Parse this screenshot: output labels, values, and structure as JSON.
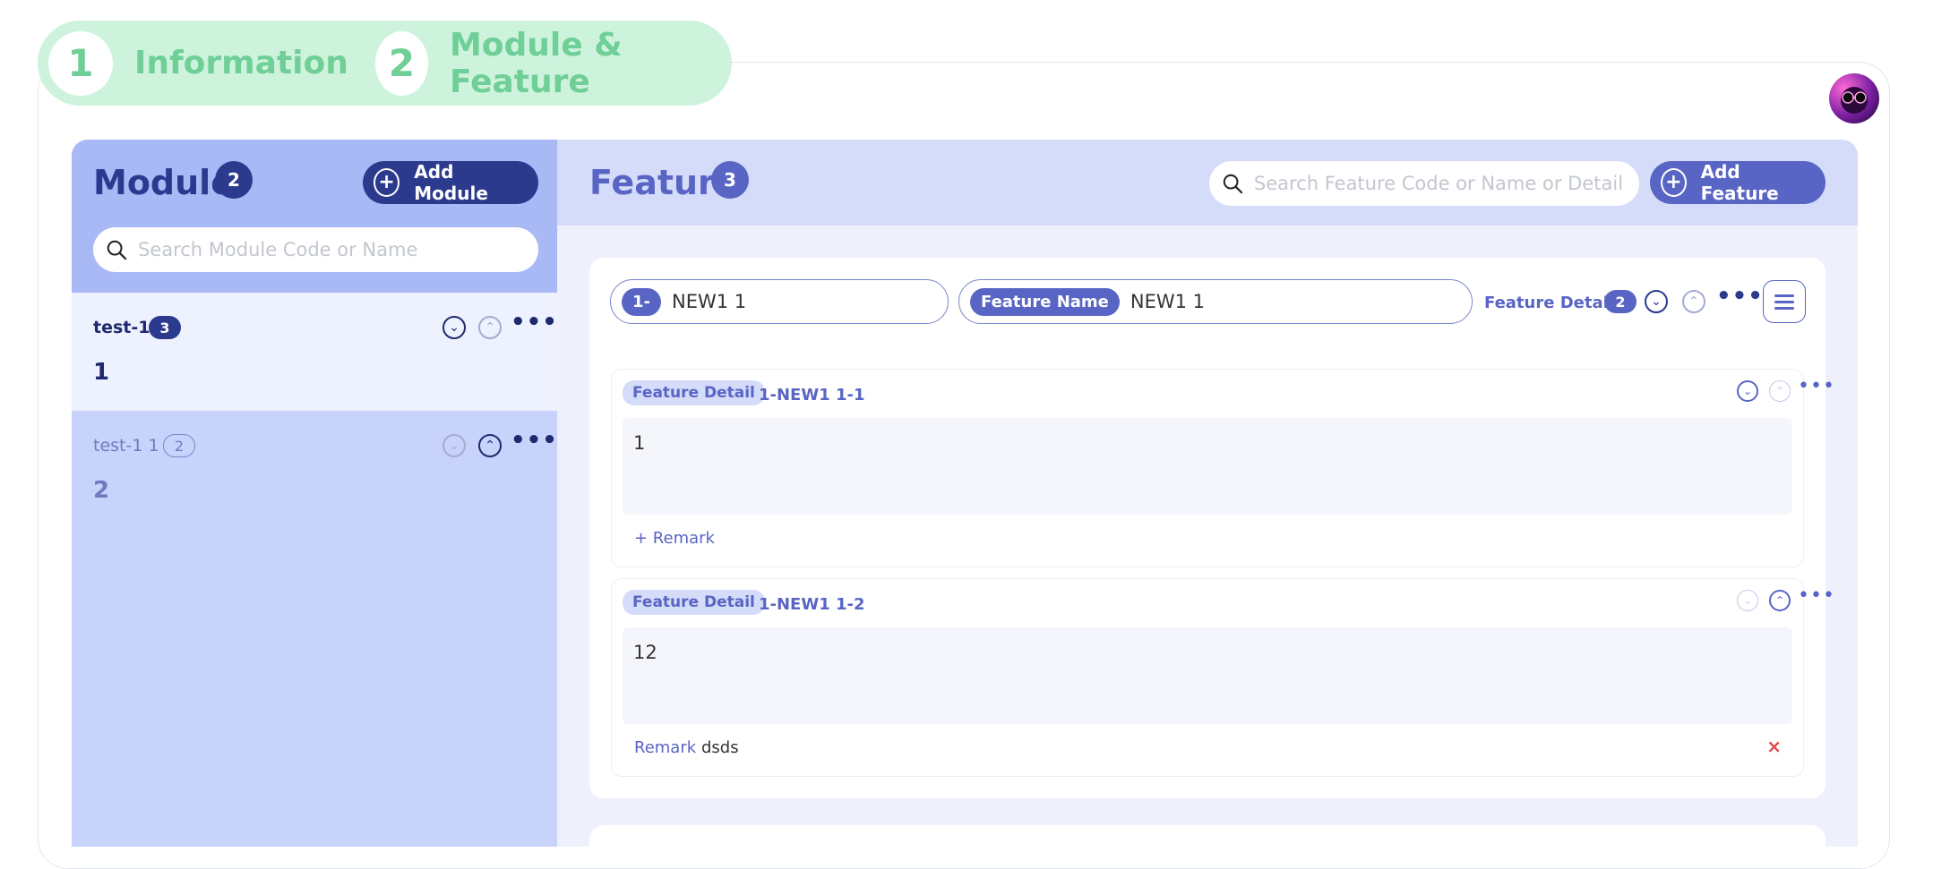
{
  "stepper": {
    "steps": [
      {
        "num": "1",
        "label": "Information"
      },
      {
        "num": "2",
        "label": "Module & Feature"
      }
    ]
  },
  "module_panel": {
    "title": "Module",
    "count": "2",
    "add_label": "Add Module",
    "search_placeholder": "Search Module Code or Name",
    "items": [
      {
        "name": "test-1",
        "count": "3",
        "value": "1"
      },
      {
        "name": "test-1 1",
        "count": "2",
        "value": "2"
      }
    ]
  },
  "feature_panel": {
    "title": "Feature",
    "count": "3",
    "search_placeholder": "Search Feature Code or Name or Detail",
    "add_label": "Add Feature",
    "feature": {
      "code_prefix": "1-",
      "code_value": "NEW1 1",
      "name_tag": "Feature Name",
      "name_value": "NEW1 1",
      "detail_label": "Feature Detail",
      "detail_count": "2"
    },
    "details": [
      {
        "tag": "Feature Detail",
        "code": "1-NEW1 1-1",
        "text": "1",
        "remark_label": "+ Remark",
        "remark_value": ""
      },
      {
        "tag": "Feature Detail",
        "code": "1-NEW1 1-2",
        "text": "12",
        "remark_label": "Remark",
        "remark_value": "dsds"
      }
    ]
  }
}
